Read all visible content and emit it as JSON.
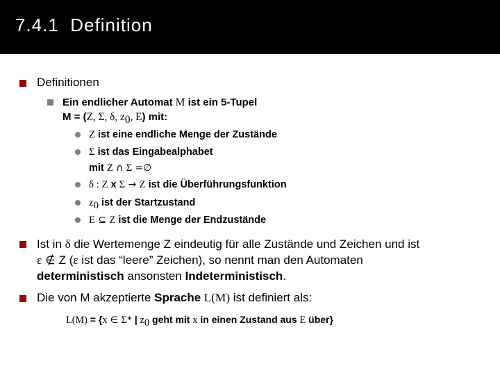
{
  "slide": {
    "title": "7.4.1  Definition",
    "title_bar_color": "#000000",
    "background_color": "#ffffff",
    "bullet_level1_color": "#990000",
    "bullet_level2_color": "#808080",
    "bullet_level3_color": "#808080"
  },
  "content": {
    "l1_definitionen": "Definitionen",
    "l2_tupel_line1_a": "Ein endlicher Automat ",
    "l2_tupel_line1_m": "M",
    "l2_tupel_line1_b": " ist ein 5-Tupel",
    "l2_tupel_line2_pre": "M = (",
    "l2_tupel_line2_Z": "Z",
    "l2_tupel_line2_c1": ", ",
    "l2_tupel_line2_Sigma": "Σ",
    "l2_tupel_line2_c2": ", ",
    "l2_tupel_line2_delta": "δ",
    "l2_tupel_line2_c3": ", ",
    "l2_tupel_line2_z": "z",
    "l2_tupel_line2_zsub": "0",
    "l2_tupel_line2_c4": ", ",
    "l2_tupel_line2_E": "E",
    "l2_tupel_line2_post": ") mit:",
    "l3_Z_sym": "Z",
    "l3_Z_text": " ist eine endliche Menge der Zustände",
    "l3_Sigma_sym": "Σ",
    "l3_Sigma_text": "  ist das Eingabealphabet",
    "l3_Sigma_sub_pre": "mit ",
    "l3_Sigma_sub_Z": "Z",
    "l3_Sigma_sub_cap": " ∩ ",
    "l3_Sigma_sub_Sigma": "Σ",
    "l3_Sigma_sub_eq": " =",
    "l3_Sigma_sub_empty": "∅",
    "l3_delta_sym": "δ",
    "l3_delta_colon": " : ",
    "l3_delta_Z1": "Z",
    "l3_delta_x": " x ",
    "l3_delta_Sigma": "Σ",
    "l3_delta_arrow": " → ",
    "l3_delta_Z2": "Z",
    "l3_delta_text": " ist die Überführungsfunktion",
    "l3_z0_sym": "z",
    "l3_z0_sub": "0",
    "l3_z0_text": " ist der Startzustand",
    "l3_E_sym": "E",
    "l3_E_subset": " ⊆ ",
    "l3_E_Z": "Z",
    "l3_E_text": " ist die Menge der Endzustände",
    "l1_det_line1_a": "Ist in ",
    "l1_det_line1_delta": "δ",
    "l1_det_line1_b": " die Wertemenge Z eindeutig für alle Zustände und Zeichen und ist",
    "l1_det_line2_eps1": "ε",
    "l1_det_line2_notin": " ∉ ",
    "l1_det_line2_a": "Z (",
    "l1_det_line2_eps2": "ε",
    "l1_det_line2_b": " ist das “leere” Zeichen), so nennt man den Automaten",
    "l1_det_line3_bold1": "deterministisch",
    "l1_det_line3_mid": " ansonsten ",
    "l1_det_line3_bold2": "Indeterministisch",
    "l1_det_line3_end": ".",
    "l1_sprache_a": "Die von M akzeptierte ",
    "l1_sprache_bold": "Sprache",
    "l1_sprache_LM": " L(M)",
    "l1_sprache_b": " ist definiert als:",
    "formula_LM": "L(M)",
    "formula_eq": " = {",
    "formula_x1": "x",
    "formula_in": " ∈ ",
    "formula_Sigma": "Σ",
    "formula_star": "*",
    "formula_bar": " | ",
    "formula_z": "z",
    "formula_zsub": "0",
    "formula_mid": " geht mit ",
    "formula_x2": "x",
    "formula_mid2": " in einen Zustand aus ",
    "formula_E": "E",
    "formula_end": " über}"
  }
}
